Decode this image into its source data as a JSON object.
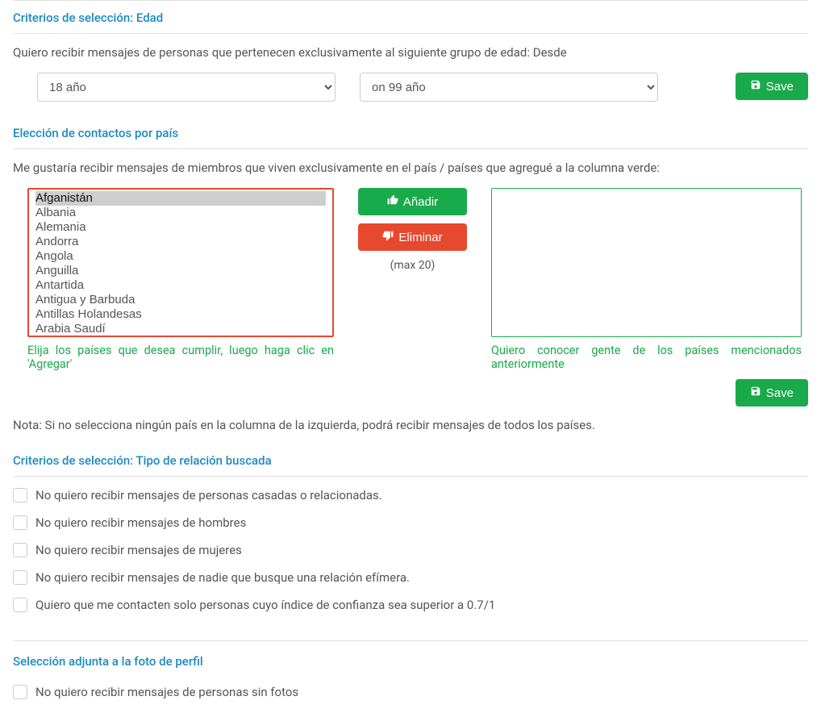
{
  "age_section": {
    "title": "Criterios de selección: Edad",
    "description": "Quiero recibir mensajes de personas que pertenecen exclusivamente al siguiente grupo de edad: Desde",
    "from_selected": "18 año",
    "to_selected": "on 99 año",
    "save_label": "Save"
  },
  "country_section": {
    "title": "Elección de contactos por país",
    "description": "Me gustaría recibir mensajes de miembros que viven exclusivamente en el país / países que agregué a la columna verde:",
    "countries": [
      "Afganistán",
      "Albania",
      "Alemania",
      "Andorra",
      "Angola",
      "Anguilla",
      "Antartida",
      "Antigua y Barbuda",
      "Antillas Holandesas",
      "Arabia Saudí"
    ],
    "add_label": "Añadir",
    "remove_label": "Eliminar",
    "max_label": "(max 20)",
    "left_hint": "Elija los países que desea cumplir, luego haga clic en 'Agregar'",
    "right_hint": "Quiero conocer gente de los países mencionados anteriormente",
    "save_label": "Save",
    "note": "Nota: Si no selecciona ningún país en la columna de la izquierda, podrá recibir mensajes de todos los países."
  },
  "relationship_section": {
    "title": "Criterios de selección: Tipo de relación buscada",
    "options": [
      "No quiero recibir mensajes de personas casadas o relacionadas.",
      "No quiero recibir mensajes de hombres",
      "No quiero recibir mensajes de mujeres",
      "No quiero recibir mensajes de nadie que busque una relación efímera.",
      "Quiero que me contacten solo personas cuyo índice de confianza sea superior a 0.7/1"
    ]
  },
  "photo_section": {
    "title": "Selección adjunta a la foto de perfil",
    "option": "No quiero recibir mensajes de personas sin fotos"
  }
}
